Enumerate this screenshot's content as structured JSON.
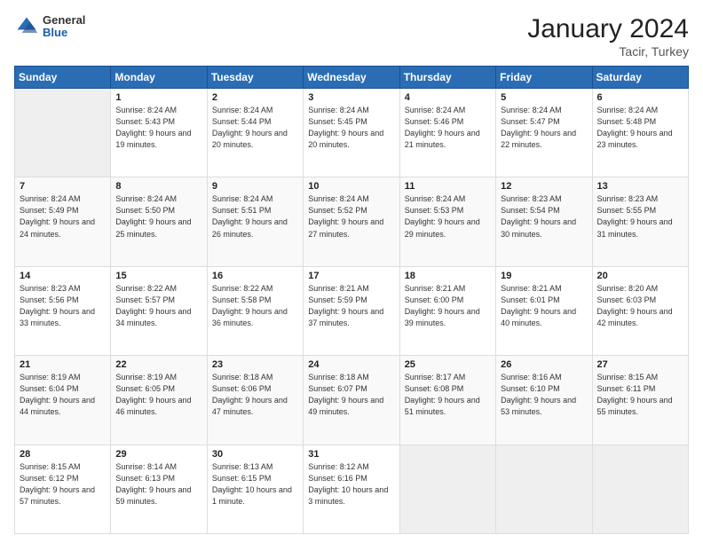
{
  "logo": {
    "general": "General",
    "blue": "Blue"
  },
  "header": {
    "title": "January 2024",
    "subtitle": "Tacir, Turkey"
  },
  "weekdays": [
    "Sunday",
    "Monday",
    "Tuesday",
    "Wednesday",
    "Thursday",
    "Friday",
    "Saturday"
  ],
  "weeks": [
    [
      {
        "day": "",
        "empty": true
      },
      {
        "day": "1",
        "sunrise": "Sunrise: 8:24 AM",
        "sunset": "Sunset: 5:43 PM",
        "daylight": "Daylight: 9 hours and 19 minutes."
      },
      {
        "day": "2",
        "sunrise": "Sunrise: 8:24 AM",
        "sunset": "Sunset: 5:44 PM",
        "daylight": "Daylight: 9 hours and 20 minutes."
      },
      {
        "day": "3",
        "sunrise": "Sunrise: 8:24 AM",
        "sunset": "Sunset: 5:45 PM",
        "daylight": "Daylight: 9 hours and 20 minutes."
      },
      {
        "day": "4",
        "sunrise": "Sunrise: 8:24 AM",
        "sunset": "Sunset: 5:46 PM",
        "daylight": "Daylight: 9 hours and 21 minutes."
      },
      {
        "day": "5",
        "sunrise": "Sunrise: 8:24 AM",
        "sunset": "Sunset: 5:47 PM",
        "daylight": "Daylight: 9 hours and 22 minutes."
      },
      {
        "day": "6",
        "sunrise": "Sunrise: 8:24 AM",
        "sunset": "Sunset: 5:48 PM",
        "daylight": "Daylight: 9 hours and 23 minutes."
      }
    ],
    [
      {
        "day": "7",
        "sunrise": "Sunrise: 8:24 AM",
        "sunset": "Sunset: 5:49 PM",
        "daylight": "Daylight: 9 hours and 24 minutes."
      },
      {
        "day": "8",
        "sunrise": "Sunrise: 8:24 AM",
        "sunset": "Sunset: 5:50 PM",
        "daylight": "Daylight: 9 hours and 25 minutes."
      },
      {
        "day": "9",
        "sunrise": "Sunrise: 8:24 AM",
        "sunset": "Sunset: 5:51 PM",
        "daylight": "Daylight: 9 hours and 26 minutes."
      },
      {
        "day": "10",
        "sunrise": "Sunrise: 8:24 AM",
        "sunset": "Sunset: 5:52 PM",
        "daylight": "Daylight: 9 hours and 27 minutes."
      },
      {
        "day": "11",
        "sunrise": "Sunrise: 8:24 AM",
        "sunset": "Sunset: 5:53 PM",
        "daylight": "Daylight: 9 hours and 29 minutes."
      },
      {
        "day": "12",
        "sunrise": "Sunrise: 8:23 AM",
        "sunset": "Sunset: 5:54 PM",
        "daylight": "Daylight: 9 hours and 30 minutes."
      },
      {
        "day": "13",
        "sunrise": "Sunrise: 8:23 AM",
        "sunset": "Sunset: 5:55 PM",
        "daylight": "Daylight: 9 hours and 31 minutes."
      }
    ],
    [
      {
        "day": "14",
        "sunrise": "Sunrise: 8:23 AM",
        "sunset": "Sunset: 5:56 PM",
        "daylight": "Daylight: 9 hours and 33 minutes."
      },
      {
        "day": "15",
        "sunrise": "Sunrise: 8:22 AM",
        "sunset": "Sunset: 5:57 PM",
        "daylight": "Daylight: 9 hours and 34 minutes."
      },
      {
        "day": "16",
        "sunrise": "Sunrise: 8:22 AM",
        "sunset": "Sunset: 5:58 PM",
        "daylight": "Daylight: 9 hours and 36 minutes."
      },
      {
        "day": "17",
        "sunrise": "Sunrise: 8:21 AM",
        "sunset": "Sunset: 5:59 PM",
        "daylight": "Daylight: 9 hours and 37 minutes."
      },
      {
        "day": "18",
        "sunrise": "Sunrise: 8:21 AM",
        "sunset": "Sunset: 6:00 PM",
        "daylight": "Daylight: 9 hours and 39 minutes."
      },
      {
        "day": "19",
        "sunrise": "Sunrise: 8:21 AM",
        "sunset": "Sunset: 6:01 PM",
        "daylight": "Daylight: 9 hours and 40 minutes."
      },
      {
        "day": "20",
        "sunrise": "Sunrise: 8:20 AM",
        "sunset": "Sunset: 6:03 PM",
        "daylight": "Daylight: 9 hours and 42 minutes."
      }
    ],
    [
      {
        "day": "21",
        "sunrise": "Sunrise: 8:19 AM",
        "sunset": "Sunset: 6:04 PM",
        "daylight": "Daylight: 9 hours and 44 minutes."
      },
      {
        "day": "22",
        "sunrise": "Sunrise: 8:19 AM",
        "sunset": "Sunset: 6:05 PM",
        "daylight": "Daylight: 9 hours and 46 minutes."
      },
      {
        "day": "23",
        "sunrise": "Sunrise: 8:18 AM",
        "sunset": "Sunset: 6:06 PM",
        "daylight": "Daylight: 9 hours and 47 minutes."
      },
      {
        "day": "24",
        "sunrise": "Sunrise: 8:18 AM",
        "sunset": "Sunset: 6:07 PM",
        "daylight": "Daylight: 9 hours and 49 minutes."
      },
      {
        "day": "25",
        "sunrise": "Sunrise: 8:17 AM",
        "sunset": "Sunset: 6:08 PM",
        "daylight": "Daylight: 9 hours and 51 minutes."
      },
      {
        "day": "26",
        "sunrise": "Sunrise: 8:16 AM",
        "sunset": "Sunset: 6:10 PM",
        "daylight": "Daylight: 9 hours and 53 minutes."
      },
      {
        "day": "27",
        "sunrise": "Sunrise: 8:15 AM",
        "sunset": "Sunset: 6:11 PM",
        "daylight": "Daylight: 9 hours and 55 minutes."
      }
    ],
    [
      {
        "day": "28",
        "sunrise": "Sunrise: 8:15 AM",
        "sunset": "Sunset: 6:12 PM",
        "daylight": "Daylight: 9 hours and 57 minutes."
      },
      {
        "day": "29",
        "sunrise": "Sunrise: 8:14 AM",
        "sunset": "Sunset: 6:13 PM",
        "daylight": "Daylight: 9 hours and 59 minutes."
      },
      {
        "day": "30",
        "sunrise": "Sunrise: 8:13 AM",
        "sunset": "Sunset: 6:15 PM",
        "daylight": "Daylight: 10 hours and 1 minute."
      },
      {
        "day": "31",
        "sunrise": "Sunrise: 8:12 AM",
        "sunset": "Sunset: 6:16 PM",
        "daylight": "Daylight: 10 hours and 3 minutes."
      },
      {
        "day": "",
        "empty": true
      },
      {
        "day": "",
        "empty": true
      },
      {
        "day": "",
        "empty": true
      }
    ]
  ]
}
